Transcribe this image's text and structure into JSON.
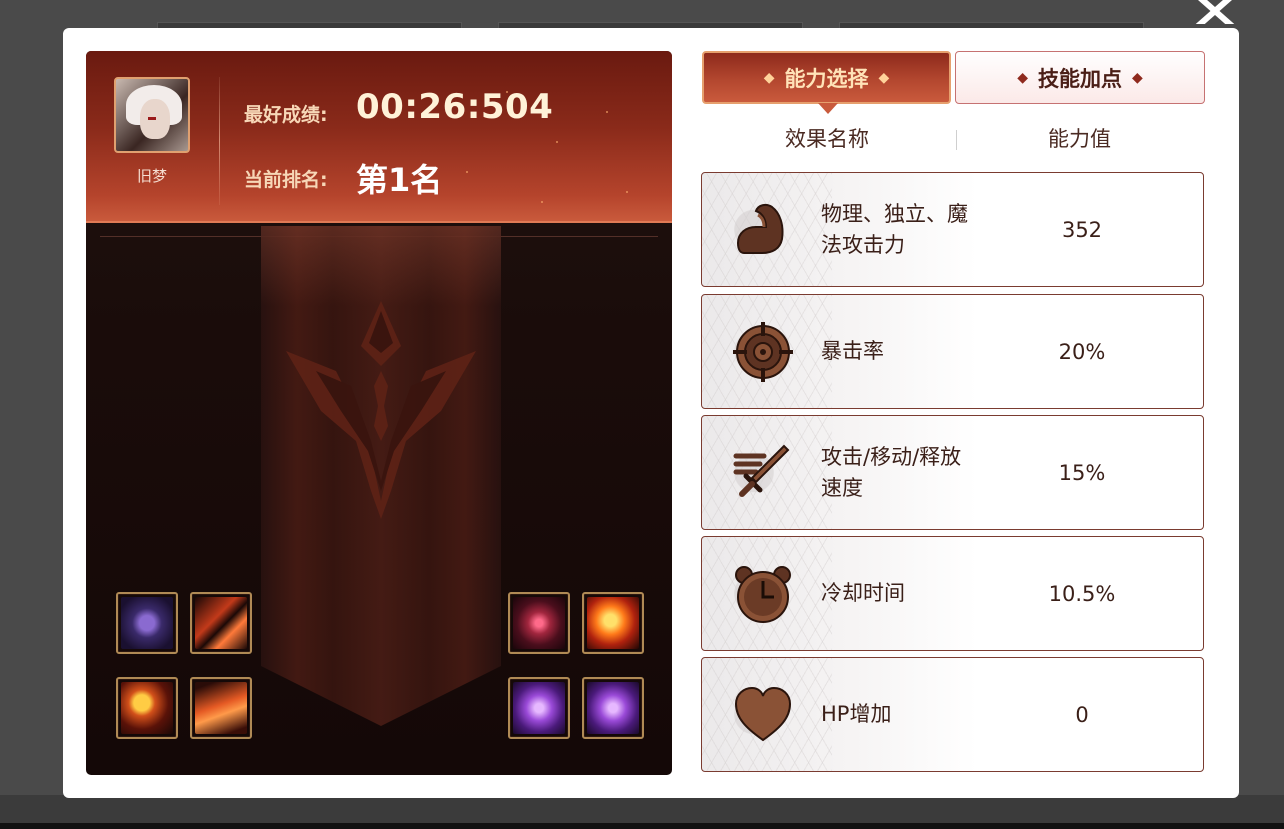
{
  "player": {
    "name": "旧梦",
    "best_label": "最好成绩:",
    "best_value": "00:26:504",
    "rank_label": "当前排名:",
    "rank_value": "第1名"
  },
  "tabs": [
    {
      "label": "能力选择",
      "active": true
    },
    {
      "label": "技能加点",
      "active": false
    }
  ],
  "columns": {
    "effect": "效果名称",
    "value": "能力值"
  },
  "stats": [
    {
      "icon": "muscle-arm-icon",
      "name": "物理、独立、魔法攻击力",
      "value": "352"
    },
    {
      "icon": "crosshair-icon",
      "name": "暴击率",
      "value": "20%"
    },
    {
      "icon": "speed-sword-icon",
      "name": "攻击/移动/释放速度",
      "value": "15%"
    },
    {
      "icon": "alarm-clock-icon",
      "name": "冷却时间",
      "value": "10.5%"
    },
    {
      "icon": "heart-icon",
      "name": "HP增加",
      "value": "0"
    }
  ],
  "equipment_slots": [
    {
      "icon": "claw-gem-icon"
    },
    {
      "icon": "fire-blade-icon"
    },
    {
      "icon": "magnifier-staff-icon"
    },
    {
      "icon": "flame-wing-icon"
    },
    {
      "icon": "crimson-swirl-icon"
    },
    {
      "icon": "flame-orb-icon"
    },
    {
      "icon": "purple-heart-gem-icon"
    },
    {
      "icon": "purple-heart-gem-icon"
    }
  ],
  "colors": {
    "accent": "#b3472f",
    "header_gold": "#f7d7b7",
    "stat_text": "#3a1f18",
    "row_border": "#7a3b30"
  }
}
